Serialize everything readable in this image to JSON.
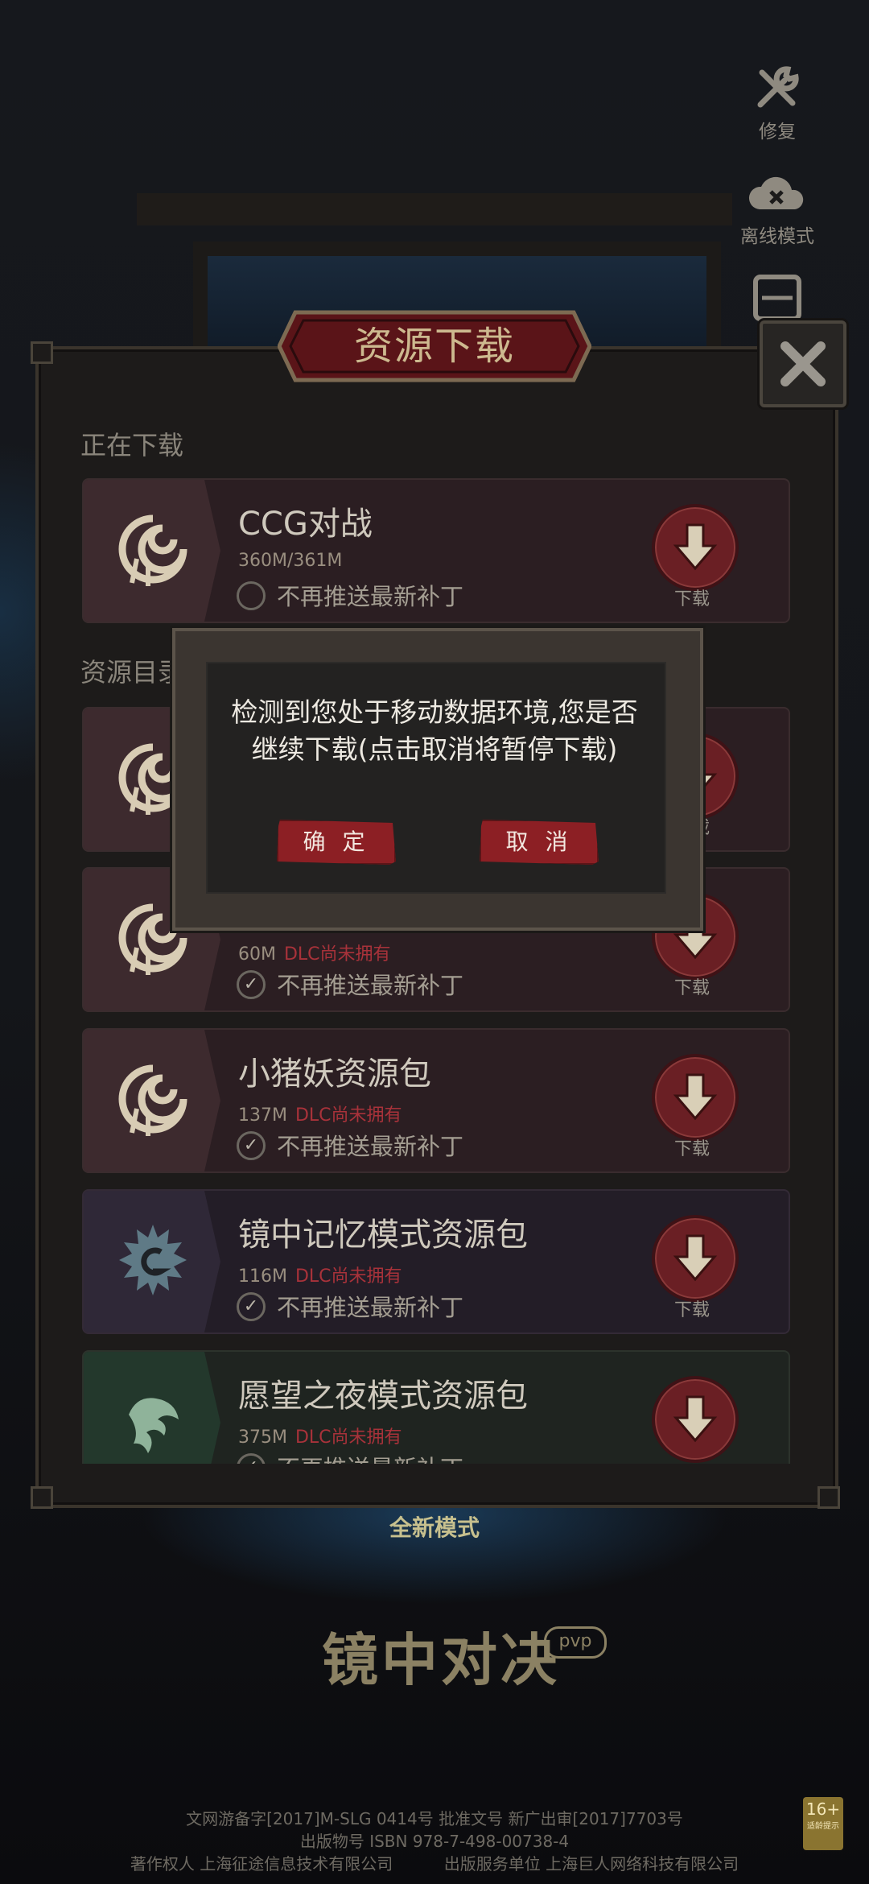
{
  "side_tools": [
    {
      "icon": "repair-icon",
      "label": "修复"
    },
    {
      "icon": "offline-cloud-icon",
      "label": "离线模式"
    }
  ],
  "dialog": {
    "title": "资源下载",
    "downloading_label": "正在下载",
    "catalog_label": "资源目录"
  },
  "downloading": {
    "title": "CCG对战",
    "size": "360M/361M",
    "no_push": "不再推送最新补丁",
    "download": "下载"
  },
  "resources": [
    {
      "title": "",
      "size": "",
      "dlc": "",
      "no_push": "",
      "download": "下载",
      "checked": true
    },
    {
      "title": "",
      "size": "60M",
      "dlc": "DLC尚未拥有",
      "no_push": "不再推送最新补丁",
      "download": "下载",
      "checked": true
    },
    {
      "title": "小猪妖资源包",
      "size": "137M",
      "dlc": "DLC尚未拥有",
      "no_push": "不再推送最新补丁",
      "download": "下载",
      "checked": true
    },
    {
      "title": "镜中记忆模式资源包",
      "size": "116M",
      "dlc": "DLC尚未拥有",
      "no_push": "不再推送最新补丁",
      "download": "下载",
      "checked": true
    },
    {
      "title": "愿望之夜模式资源包",
      "size": "375M",
      "dlc": "DLC尚未拥有",
      "no_push": "不再推送最新补丁",
      "download": "",
      "checked": true
    }
  ],
  "modal": {
    "message": "检测到您处于移动数据环境,您是否\n继续下载(点击取消将暂停下载)",
    "confirm": "确 定",
    "cancel": "取 消"
  },
  "background": {
    "mode_hint": "全新模式",
    "logo": "镜中对决",
    "logo_badge": "pvp"
  },
  "footer": {
    "line1": "文网游备字[2017]M-SLG 0414号 批准文号 新广出审[2017]7703号",
    "line2": "出版物号 ISBN 978-7-498-00738-4",
    "line3": "著作权人 上海征途信息技术有限公司          出版服务单位 上海巨人网络科技有限公司",
    "age_rating": "16+",
    "age_note": "适龄提示"
  },
  "colors": {
    "accent_red": "#8c1f24",
    "dlc_red": "#a8323a",
    "panel_bg": "#1d1b1a",
    "title_gold": "#cdb98f"
  }
}
